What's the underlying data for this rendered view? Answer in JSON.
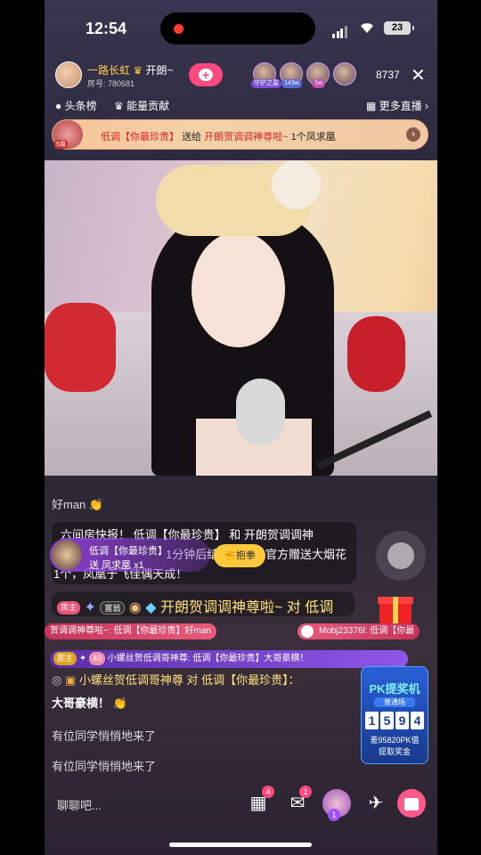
{
  "status": {
    "time": "12:54",
    "battery": "23"
  },
  "host": {
    "name": "一路长虹",
    "follow_suffix": "开朗~",
    "room_label": "房号",
    "room_id": "780681"
  },
  "guards": [
    "守护之星",
    "143w",
    "1w"
  ],
  "viewers": "8737",
  "tabs": {
    "headline": "头条榜",
    "contribution": "能量贡献",
    "more": "更多直播"
  },
  "notice": {
    "badge": "5周",
    "sender": "低调【你最珍贵】",
    "verb": "送给",
    "receiver": "开朗贺调调神尊啦~",
    "gift": "1个凤求凰"
  },
  "chat": {
    "c1": "好man",
    "c2_line1": "六间房快报！ 低调【你最珍贵】 和 开朗贺调调神",
    "c2_line2_a": "1分钟后结",
    "c2_line2_b": "官方赠送大烟花",
    "c2_line3": "1个，凤凰于飞佳偶天成！",
    "gift_user": "低调【你最珍贵】",
    "gift_item": "送 凤求凰 x1",
    "hug": "抱拳",
    "c3_tag": "房主",
    "c3_rank": "富翁",
    "c3_text": "开朗贺调调神尊啦~ 对 低调",
    "ticker_a": "贺调调神尊啦~: 低调【你最珍贵】好man",
    "ticker_b": "Mobj23376l: 低调【你最",
    "big_tag": "郡主",
    "big_lvl": "40",
    "big_text": "小螺丝贺低调哥神尊: 低调【你最珍贵】大哥豪横！",
    "c4_text": "小螺丝贺低调哥神尊 对 低调【你最珍贵】：",
    "c4_text2": "大哥豪横！",
    "c5": "有位同学悄悄地来了",
    "c6": "有位同学悄悄地来了"
  },
  "pk": {
    "title": "PK提奖机",
    "sub": "普通场",
    "digits": [
      "1",
      "5",
      "9",
      "4"
    ],
    "note": "差95820PK值",
    "note2": "提取奖金"
  },
  "bottom": {
    "placeholder": "聊聊吧...",
    "badge1": "4",
    "badge2": "1",
    "badge3": "1"
  }
}
